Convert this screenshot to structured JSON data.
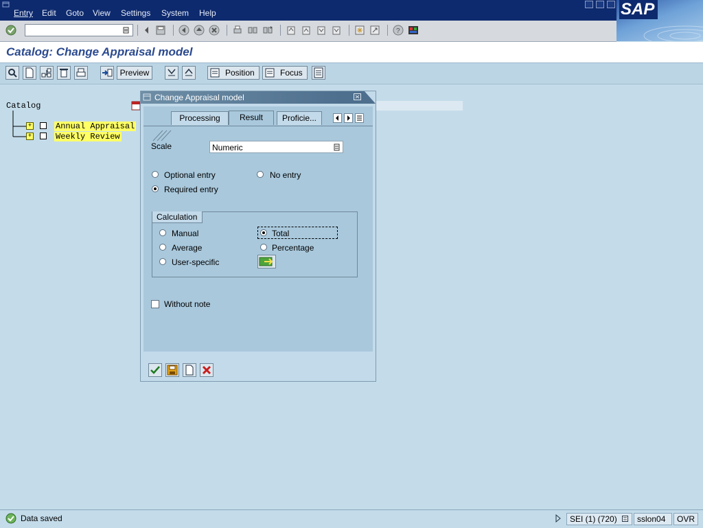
{
  "menubar": {
    "items": [
      "Entry",
      "Edit",
      "Goto",
      "View",
      "Settings",
      "System",
      "Help"
    ],
    "logo_text": "SAP"
  },
  "systoolbar": {
    "command_value": ""
  },
  "page": {
    "title": "Catalog: Change Appraisal model"
  },
  "apptoolbar": {
    "preview_label": "Preview",
    "position_label": "Position",
    "focus_label": "Focus"
  },
  "tree": {
    "header": "Catalog",
    "nodes": [
      {
        "label": "Annual Appraisal"
      },
      {
        "label": "Weekly Review"
      }
    ]
  },
  "dialog": {
    "title": "Change Appraisal model",
    "tabs": [
      "Processing",
      "Result",
      "Proficie..."
    ],
    "active_tab": "Result",
    "scale_label": "Scale",
    "scale_value": "Numeric",
    "entry_options": {
      "optional": "Optional entry",
      "no_entry": "No entry",
      "required": "Required entry",
      "selected": "Required entry"
    },
    "calculation": {
      "title": "Calculation",
      "manual": "Manual",
      "total": "Total",
      "average": "Average",
      "percentage": "Percentage",
      "user_specific": "User-specific",
      "selected": "Total"
    },
    "without_note_label": "Without note",
    "without_note_checked": false
  },
  "statusbar": {
    "message": "Data saved",
    "system": "SEI (1) (720)",
    "server": "sslon04",
    "mode": "OVR"
  },
  "colors": {
    "menubar": "#0e2a6e",
    "background": "#c4dcea",
    "title_text": "#2b4a8f",
    "highlight": "#ffff66"
  }
}
